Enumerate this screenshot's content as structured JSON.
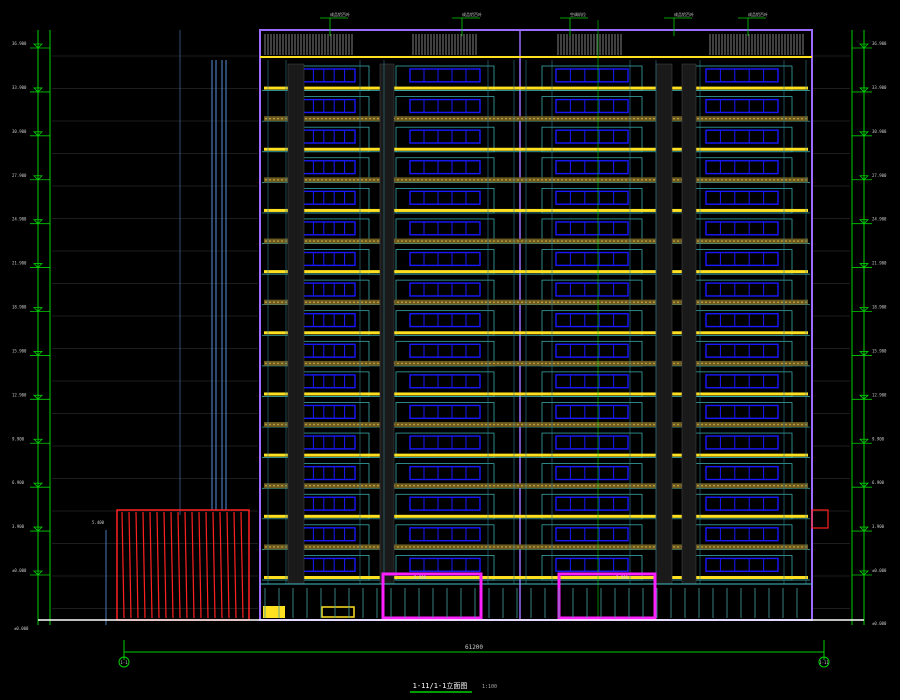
{
  "drawing": {
    "title": "1-11/1-1立面图",
    "scale": "1:100",
    "bottom_dimension": "61200",
    "axis_left": "1-1",
    "axis_right": "1-11"
  },
  "elevations": {
    "levels": [
      "36.900",
      "33.900",
      "30.900",
      "27.900",
      "24.900",
      "21.900",
      "18.900",
      "15.900",
      "12.900",
      "9.900",
      "6.900",
      "3.900",
      "±0.000"
    ]
  },
  "top_labels": [
    "成品铝百叶",
    "成品铝百叶",
    "空调机位",
    "成品铝百叶",
    "成品铝百叶"
  ],
  "notes": {
    "left_bottom": "±0.000",
    "right_bottom": "±0.000",
    "annex_top": "5.400",
    "entrance_left": "3.900",
    "entrance_right": "3.900"
  },
  "colors": {
    "bg": "#000000",
    "frame": "#9a6cff",
    "window": "#1818ff",
    "rail": "#ffe020",
    "green": "#00d000",
    "red": "#ff2020",
    "magenta": "#ff20ff",
    "cyan": "#40c0c0",
    "white": "#ffffff"
  }
}
